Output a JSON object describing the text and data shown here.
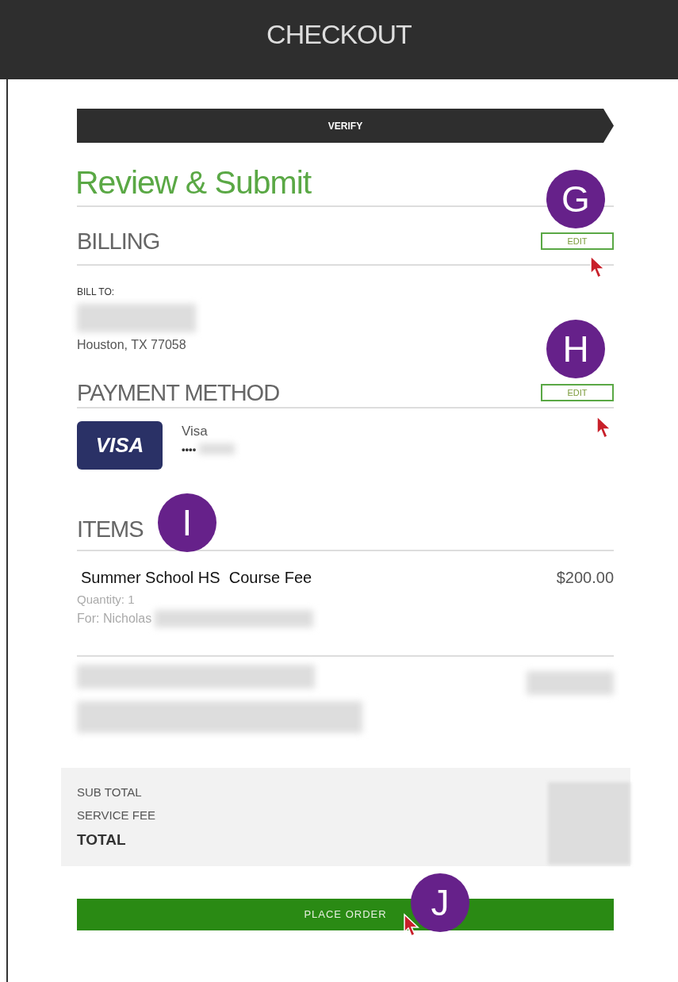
{
  "header": {
    "title": "CHECKOUT"
  },
  "progress_step": "VERIFY",
  "page_title": "Review & Submit",
  "billing": {
    "heading": "BILLING",
    "edit_button": "EDIT",
    "callout": "G",
    "bill_to_label": "BILL TO:",
    "city_line": "Houston, TX 77058"
  },
  "payment": {
    "heading": "PAYMENT METHOD",
    "edit_button": "EDIT",
    "callout": "H",
    "card_logo": "VISA",
    "card_name": "Visa",
    "card_mask": "••••"
  },
  "items": {
    "heading": "ITEMS",
    "callout": "I",
    "list": [
      {
        "name": "Summer School HS  Course Fee",
        "price": "$200.00",
        "quantity": "Quantity: 1",
        "for": "For: Nicholas"
      }
    ]
  },
  "summary": {
    "rows": [
      {
        "label": "SUB TOTAL",
        "kind": "line"
      },
      {
        "label": "SERVICE FEE",
        "kind": "line"
      },
      {
        "label": "TOTAL",
        "kind": "total"
      }
    ]
  },
  "place_order": {
    "label": "PLACE ORDER",
    "callout": "J"
  }
}
